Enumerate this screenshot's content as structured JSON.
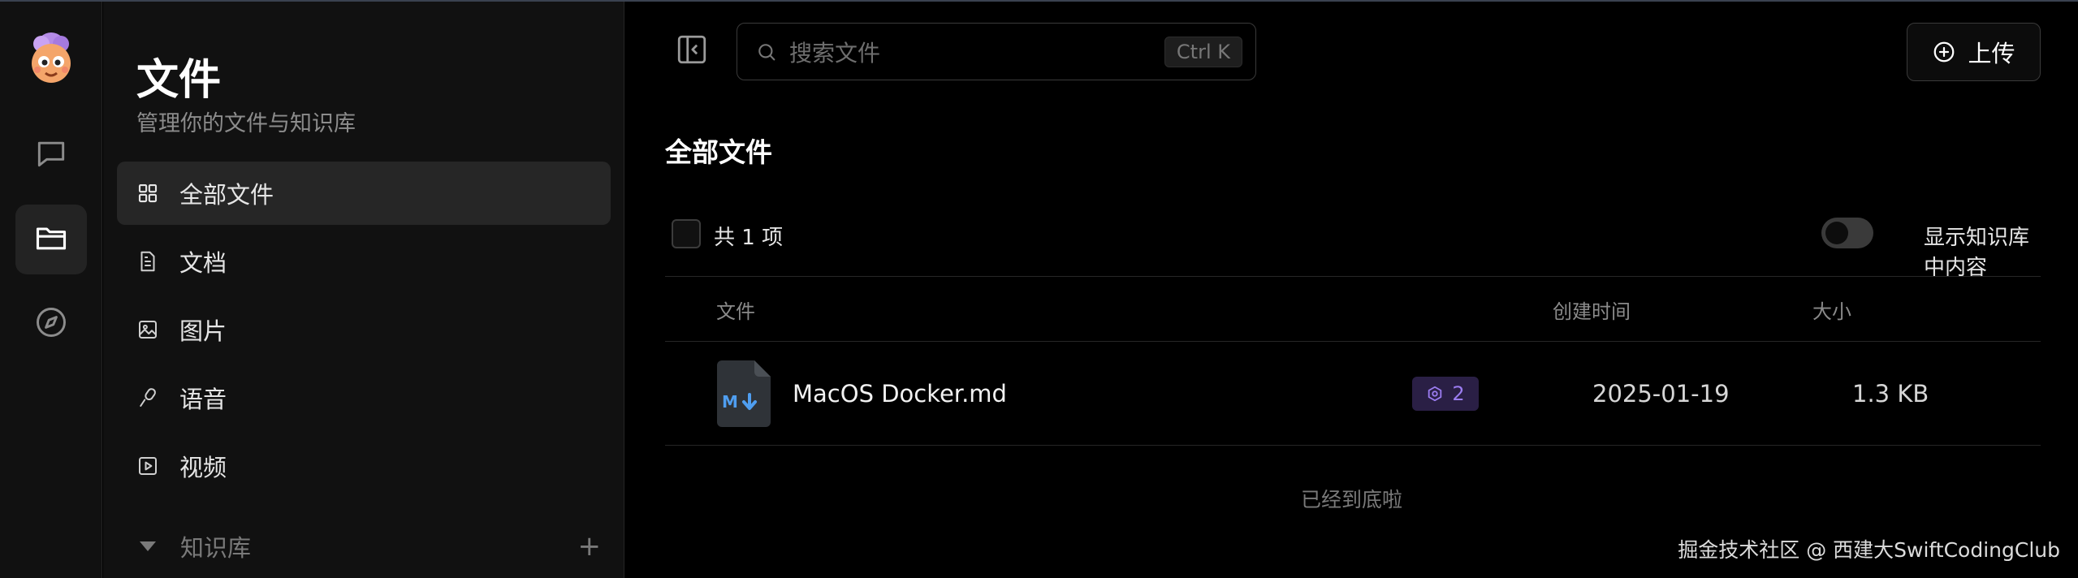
{
  "rail": {
    "items": [
      {
        "name": "chat",
        "icon": "chat-icon"
      },
      {
        "name": "files",
        "icon": "folder-icon",
        "active": true
      },
      {
        "name": "discover",
        "icon": "compass-icon"
      }
    ]
  },
  "sidebar": {
    "title": "文件",
    "subtitle": "管理你的文件与知识库",
    "items": [
      {
        "label": "全部文件",
        "icon": "grid-icon",
        "active": true
      },
      {
        "label": "文档",
        "icon": "document-icon"
      },
      {
        "label": "图片",
        "icon": "image-icon"
      },
      {
        "label": "语音",
        "icon": "microphone-icon"
      },
      {
        "label": "视频",
        "icon": "video-icon"
      }
    ],
    "knowledge_base": {
      "label": "知识库",
      "add": "+"
    }
  },
  "header": {
    "search_placeholder": "搜索文件",
    "search_shortcut": "Ctrl K",
    "upload_label": "上传"
  },
  "main": {
    "title": "全部文件",
    "count_label": "共 1 项",
    "toggle_label": "显示知识库中内容",
    "toggle_on": false,
    "columns": [
      "文件",
      "创建时间",
      "大小"
    ],
    "rows": [
      {
        "name": "MacOS Docker.md",
        "kb_count": "2",
        "created": "2025-01-19",
        "size": "1.3 KB",
        "file_type_icon": "markdown-file-icon"
      }
    ],
    "end_text": "已经到底啦"
  },
  "watermark": "掘金技术社区 @ 西建大SwiftCodingClub",
  "colors": {
    "background": "#000000",
    "sidebar": "#111111",
    "active_item": "#262626",
    "badge_bg": "#2a1f45",
    "badge_fg": "#9b7cf0",
    "markdown_blue": "#4f9ef0"
  }
}
